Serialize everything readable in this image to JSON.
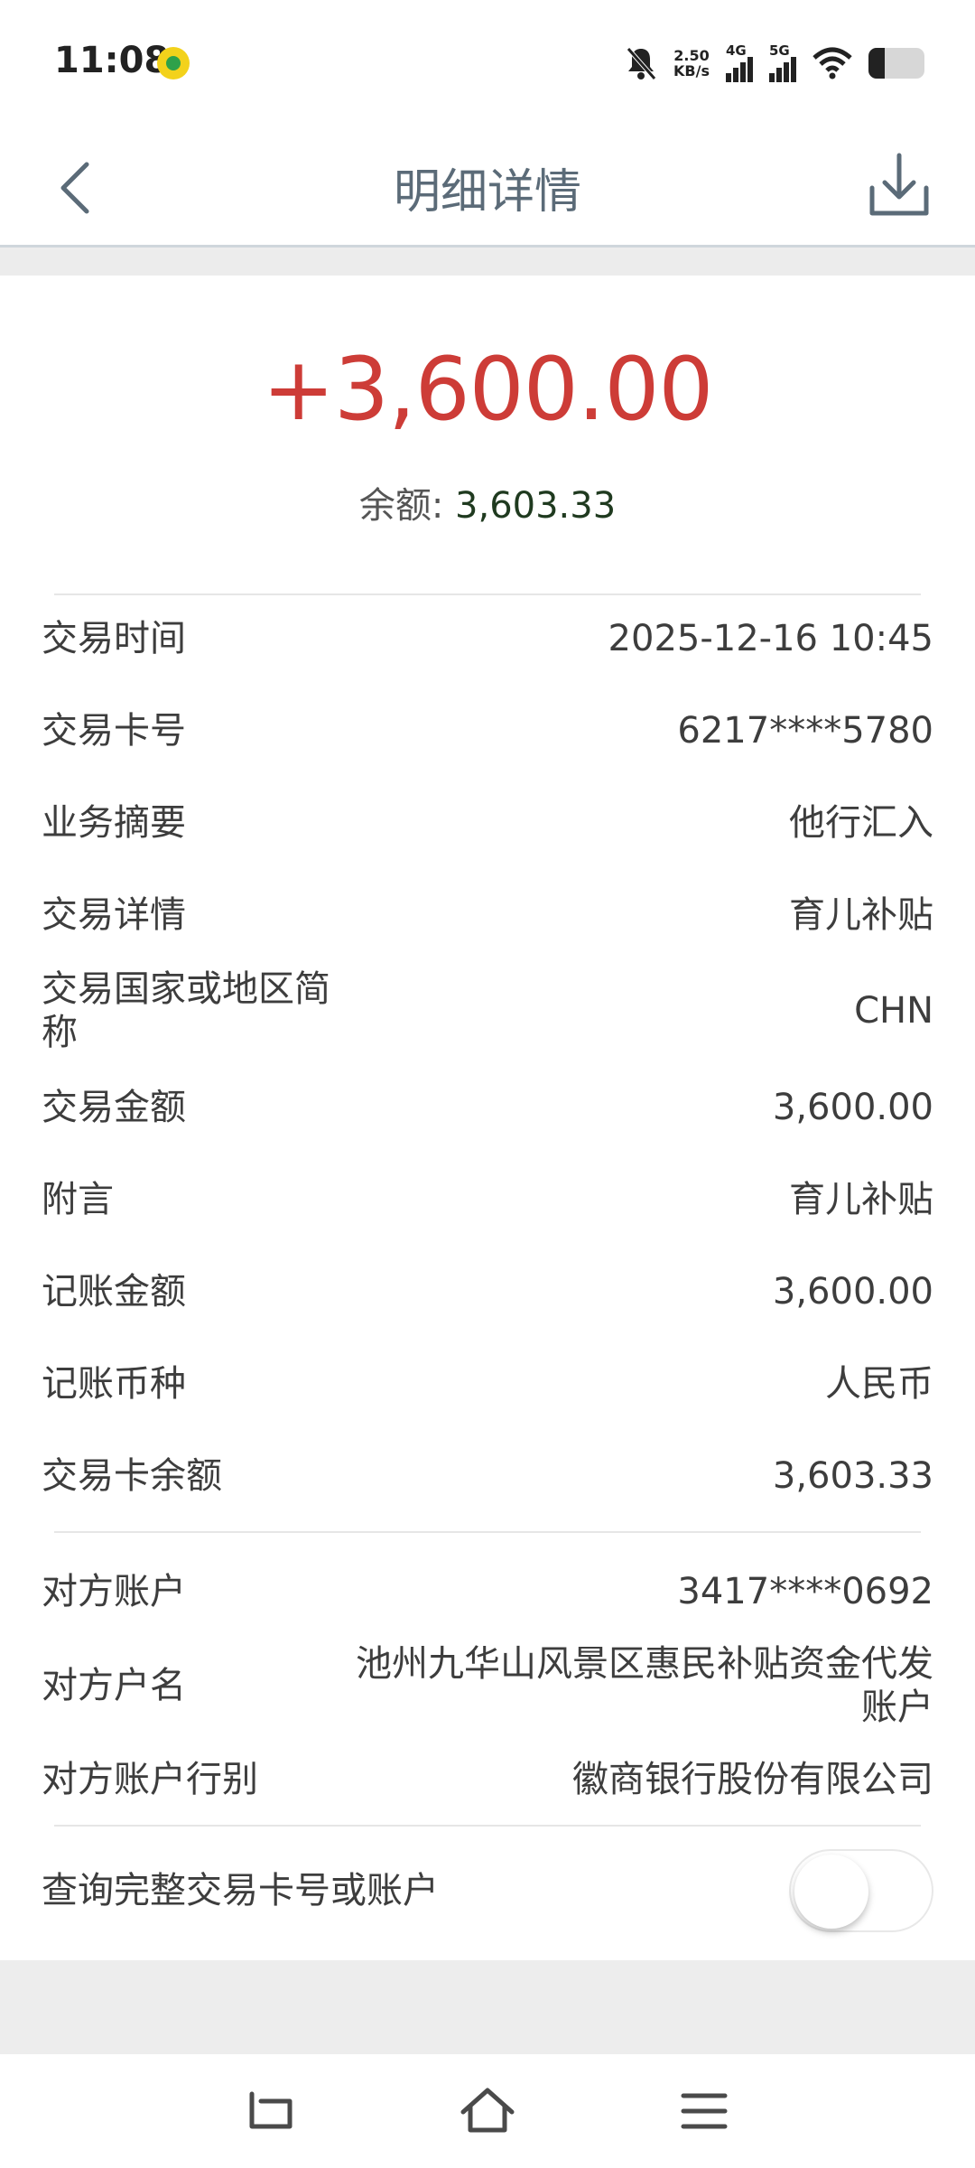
{
  "status_bar": {
    "time": "11:08",
    "net_speed_value": "2.50",
    "net_speed_unit": "KB/s",
    "sim1": "4G",
    "sim2": "5G",
    "icons": [
      "app-notification-icon",
      "mute-icon",
      "signal-icon",
      "wifi-icon",
      "battery-icon"
    ]
  },
  "header": {
    "title": "明细详情",
    "back_icon": "chevron-left-icon",
    "download_icon": "download-icon"
  },
  "summary": {
    "amount": "+3,600.00",
    "amount_color": "#cd3c37",
    "balance_label": "余额: ",
    "balance_value": "3,603.33"
  },
  "details": [
    {
      "label": "交易时间",
      "value": "2025-12-16 10:45"
    },
    {
      "label": "交易卡号",
      "value": "6217****5780"
    },
    {
      "label": "业务摘要",
      "value": "他行汇入"
    },
    {
      "label": "交易详情",
      "value": "育儿补贴"
    },
    {
      "label": "交易国家或地区简称",
      "value": "CHN"
    },
    {
      "label": "交易金额",
      "value": "3,600.00"
    },
    {
      "label": "附言",
      "value": "育儿补贴"
    },
    {
      "label": "记账金额",
      "value": "3,600.00"
    },
    {
      "label": "记账币种",
      "value": "人民币"
    },
    {
      "label": "交易卡余额",
      "value": "3,603.33"
    }
  ],
  "counterparty": [
    {
      "label": "对方账户",
      "value": "3417****0692"
    },
    {
      "label": "对方户名",
      "value": "池州九华山风景区惠民补贴资金代发账户"
    },
    {
      "label": "对方账户行别",
      "value": "徽商银行股份有限公司"
    }
  ],
  "toggle_row": {
    "label": "查询完整交易卡号或账户",
    "enabled": false
  },
  "navbar": {
    "icons": [
      "back-nav-icon",
      "home-icon",
      "menu-icon"
    ]
  }
}
